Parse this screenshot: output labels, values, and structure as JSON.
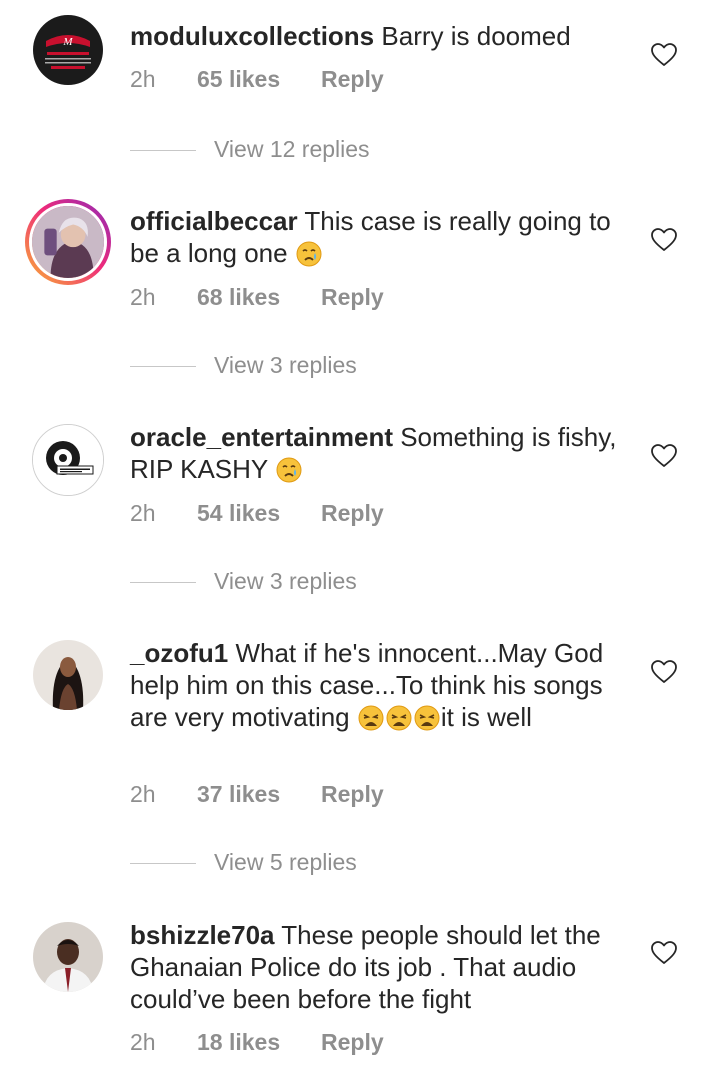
{
  "comments": [
    {
      "username": "moduluxcollections",
      "text": "Barry is doomed",
      "time": "2h",
      "likes": "65 likes",
      "reply": "Reply",
      "view_replies": "View 12 replies",
      "avatar_icon": "modulux-logo-avatar"
    },
    {
      "username": "officialbeccar",
      "text": "This case is really going to be a long one",
      "emojis": [
        "crying-face"
      ],
      "time": "2h",
      "likes": "68 likes",
      "reply": "Reply",
      "view_replies": "View 3 replies",
      "avatar_icon": "profile-photo-avatar"
    },
    {
      "username": "oracle_entertainment",
      "text": "Something is fishy, RIP KASHY",
      "emojis": [
        "crying-face"
      ],
      "time": "2h",
      "likes": "54 likes",
      "reply": "Reply",
      "view_replies": "View 3 replies",
      "avatar_icon": "oracle-logo-avatar"
    },
    {
      "username": "_ozofu1",
      "text_before": "What if he's innocent...May God help him on this case...To think his songs are very motivating",
      "emojis": [
        "weary-face",
        "weary-face",
        "weary-face"
      ],
      "text_after": "it is well",
      "time": "2h",
      "likes": "37 likes",
      "reply": "Reply",
      "view_replies": "View 5 replies",
      "avatar_icon": "profile-photo-avatar"
    },
    {
      "username": "bshizzle70a",
      "text": "These people should let the Ghanaian Police do its job . That audio could’ve been before the fight",
      "time": "2h",
      "likes": "18 likes",
      "reply": "Reply",
      "avatar_icon": "profile-photo-avatar"
    }
  ],
  "colors": {
    "text": "#262626",
    "secondary": "#8e8e8e",
    "emoji_yellow": "#f7c23b",
    "story_ring": [
      "#f9b233",
      "#ee2a7b",
      "#8b2bb9"
    ]
  }
}
